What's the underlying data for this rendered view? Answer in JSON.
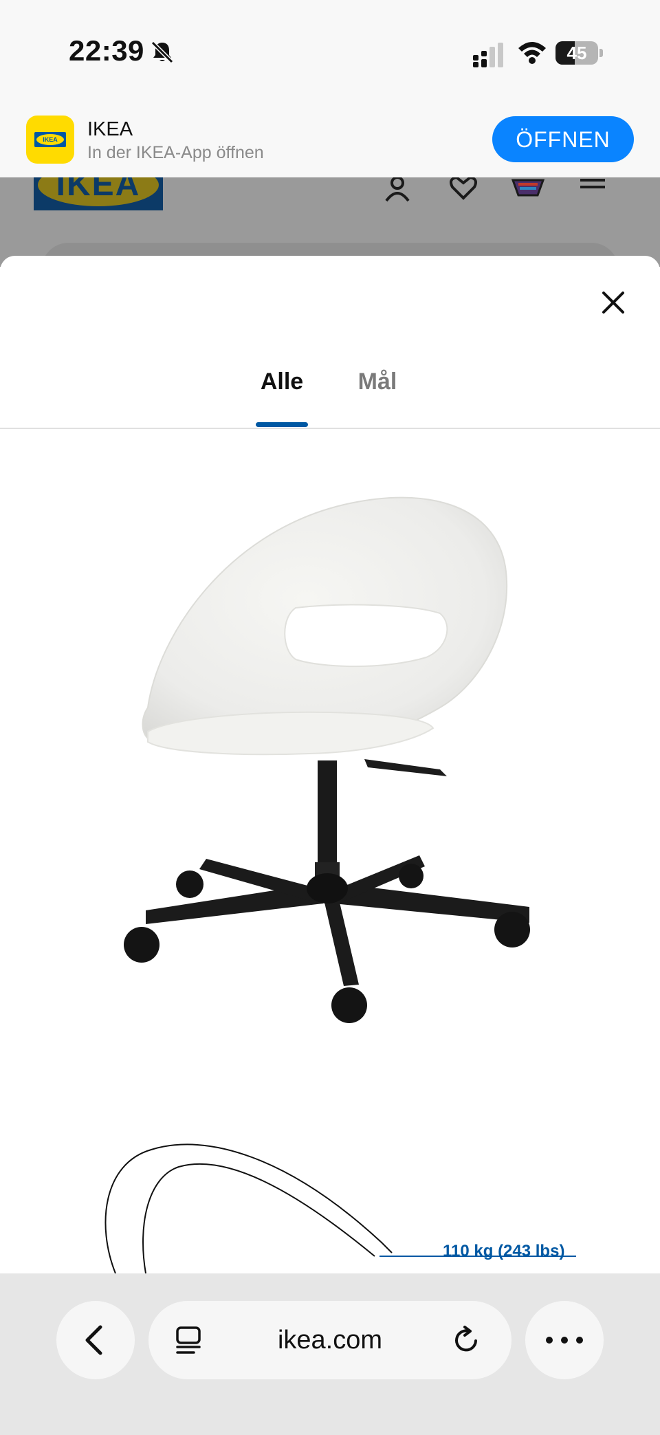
{
  "status_bar": {
    "time": "22:39",
    "battery_level": "45",
    "battery_fraction": 0.45,
    "icons": [
      "bell-slash-icon",
      "signal-icon",
      "wifi-icon",
      "battery-icon"
    ]
  },
  "app_banner": {
    "app_name": "IKEA",
    "subtitle": "In der IKEA-App öffnen",
    "open_label": "ÖFFNEN",
    "accent": "#0a84ff"
  },
  "site_header": {
    "logo_text": "IKEA",
    "icons": [
      "user-icon",
      "heart-icon",
      "cart-icon",
      "menu-icon"
    ]
  },
  "gallery": {
    "tabs": [
      {
        "label": "Alle",
        "active": true
      },
      {
        "label": "Mål",
        "active": false
      }
    ],
    "indicator_color": "#0058a3",
    "weight_label": "110 kg (243 lbs)"
  },
  "browser": {
    "url": "ikea.com",
    "icons": [
      "back-icon",
      "reader-icon",
      "reload-icon",
      "more-icon"
    ]
  },
  "colors": {
    "ikea_blue": "#0058a3",
    "ikea_yellow": "#ffdb00"
  }
}
